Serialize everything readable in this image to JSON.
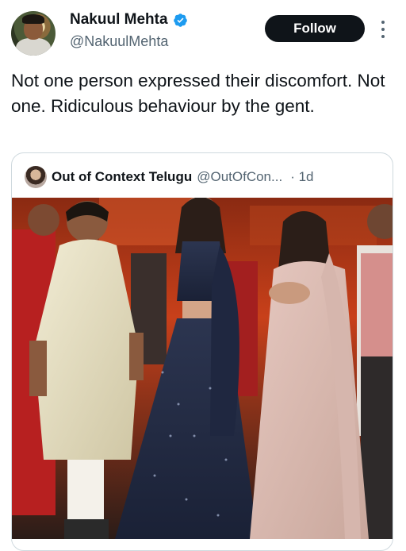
{
  "author": {
    "display_name": "Nakuul Mehta",
    "handle": "@NakuulMehta",
    "verified_icon": "verified-badge-icon",
    "verified_color": "#1d9bf0"
  },
  "actions": {
    "follow_label": "Follow",
    "more_icon": "more-options-icon"
  },
  "tweet": {
    "text": "Not one person expressed their discomfort. Not one. Ridiculous behaviour by the gent."
  },
  "quoted_tweet": {
    "display_name": "Out of Context Telugu",
    "handle": "@OutOfCon...",
    "time": "· 1d"
  },
  "colors": {
    "text_primary": "#0f1419",
    "text_secondary": "#536471",
    "border": "#cfd9de",
    "follow_bg": "#0f1419"
  }
}
